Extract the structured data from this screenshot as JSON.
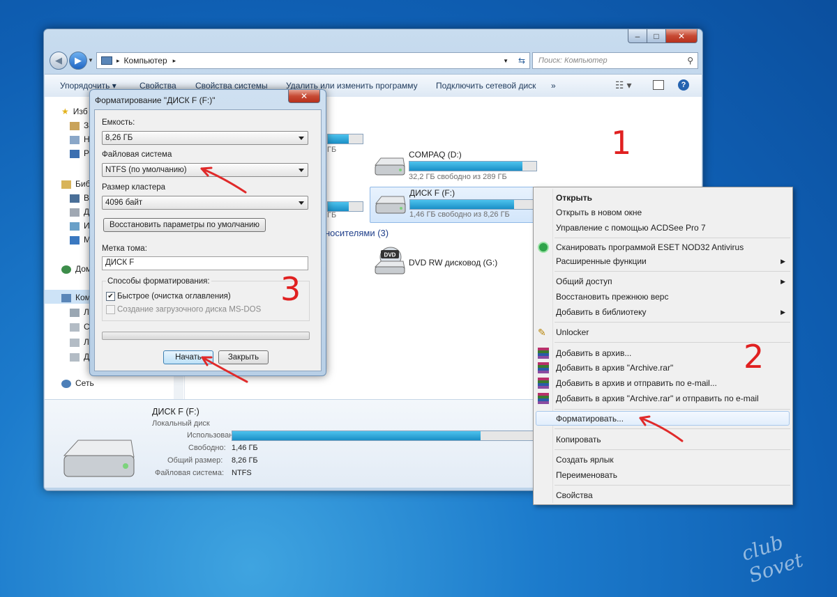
{
  "explorer": {
    "breadcrumb": "Компьютер",
    "search_placeholder": "Поиск: Компьютер",
    "toolbar": [
      "Упорядочить ▾",
      "Свойства",
      "Свойства системы",
      "Удалить или изменить программу",
      "Подключить сетевой диск",
      "»"
    ],
    "nav_partial": [
      "Изб",
      "За",
      "Н",
      "Ра",
      "Биб",
      "Ви",
      "Д",
      "И",
      "М",
      "Дом",
      "Ком",
      "Ло",
      "С",
      "Л",
      "Д",
      "Сеть"
    ],
    "drives": [
      {
        "name": "COMPAQ (D:)",
        "free": "32,2 ГБ свободно из 289 ГБ",
        "used_fraction": 0.89
      },
      {
        "name": "ДИСК F (F:)",
        "free": "1,46 ГБ свободно из 8,26 ГБ",
        "used_fraction": 0.82
      }
    ],
    "hidden_free_suffix": [
      "ГБ",
      "ГБ"
    ],
    "removable_header": "носителями (3)",
    "dvd": {
      "name": "DVD RW дисковод (G:)",
      "label": "DVD"
    },
    "details": {
      "title": "ДИСК F (F:)",
      "type": "Локальный диск",
      "used_label": "Использовано:",
      "free_label": "Свободно:",
      "free_value": "1,46 ГБ",
      "total_label": "Общий размер:",
      "total_value": "8,26 ГБ",
      "fs_label": "Файловая система:",
      "fs_value": "NTFS"
    }
  },
  "dialog": {
    "title": "Форматирование \"ДИСК F (F:)\"",
    "capacity_label": "Емкость:",
    "capacity_value": "8,26 ГБ",
    "fs_label": "Файловая система",
    "fs_value": "NTFS (по умолчанию)",
    "cluster_label": "Размер кластера",
    "cluster_value": "4096 байт",
    "restore_button": "Восстановить параметры по умолчанию",
    "volume_label": "Метка тома:",
    "volume_value": "ДИСК F",
    "methods_label": "Способы форматирования:",
    "quick_label": "Быстрое (очистка оглавления)",
    "msdos_label": "Создание загрузочного диска MS-DOS",
    "start_button": "Начать",
    "close_button": "Закрыть"
  },
  "context_menu": {
    "open": "Открыть",
    "open_new": "Открыть в новом окне",
    "acdsee": "Управление с помощью ACDSee Pro 7",
    "eset": "Сканировать программой ESET NOD32 Antivirus",
    "advanced": "Расширенные функции",
    "share": "Общий доступ",
    "restore": "Восстановить прежнюю верс",
    "library": "Добавить в библиотеку",
    "unlocker": "Unlocker",
    "arch1": "Добавить в архив...",
    "arch2": "Добавить в архив \"Archive.rar\"",
    "arch3": "Добавить в архив и отправить по e-mail...",
    "arch4": "Добавить в архив \"Archive.rar\" и отправить по e-mail",
    "format": "Форматировать...",
    "copy": "Копировать",
    "shortcut": "Создать ярлык",
    "rename": "Переименовать",
    "properties": "Свойства"
  },
  "annotations": [
    "1",
    "2",
    "3"
  ],
  "watermark": "club Sovet",
  "colors": {
    "accent_red": "#e02020",
    "bar_fill": "#1a8fc6"
  }
}
